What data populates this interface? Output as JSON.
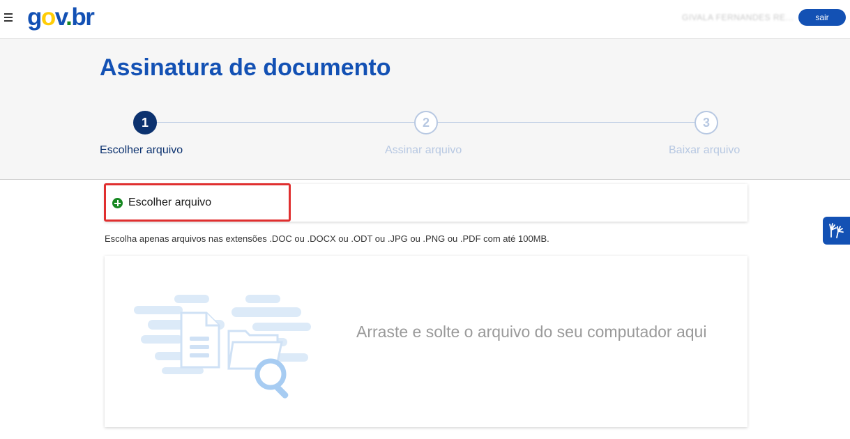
{
  "header": {
    "logo": "gov.br",
    "user_name": "GIVALA FERNANDES RE...",
    "logout_label": "sair"
  },
  "page": {
    "title": "Assinatura de documento"
  },
  "steps": [
    {
      "number": "1",
      "label": "Escolher arquivo",
      "state": "active"
    },
    {
      "number": "2",
      "label": "Assinar arquivo",
      "state": "inactive"
    },
    {
      "number": "3",
      "label": "Baixar arquivo",
      "state": "inactive"
    }
  ],
  "upload": {
    "choose_label": "Escolher arquivo",
    "hint": "Escolha apenas arquivos nas extensões .DOC ou .DOCX ou .ODT ou .JPG ou .PNG ou .PDF com até 100MB.",
    "drop_text": "Arraste e solte o arquivo do seu computador aqui"
  },
  "icons": {
    "menu": "hamburger-icon",
    "add": "plus-circle-icon",
    "illustration": "document-folder-search-icon",
    "accessibility": "sign-language-hands-icon"
  },
  "colors": {
    "brand_blue": "#1351b4",
    "dark_blue": "#0c326f",
    "step_inactive": "#b7c8e2",
    "highlight_red": "#e02f2f",
    "add_green": "#168821"
  }
}
